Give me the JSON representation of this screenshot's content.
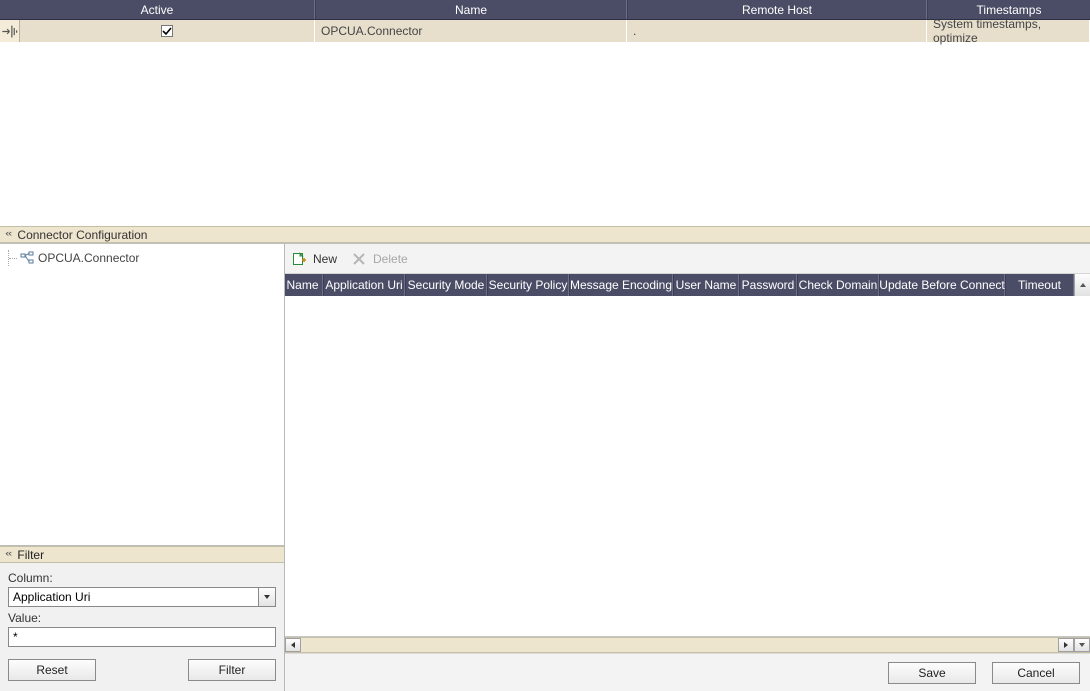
{
  "top_table": {
    "columns": {
      "active": "Active",
      "name": "Name",
      "remote_host": "Remote Host",
      "timestamps": "Timestamps"
    },
    "rows": [
      {
        "active_checked": true,
        "name": "OPCUA.Connector",
        "remote_host": ".",
        "timestamps": "System timestamps, optimize"
      }
    ]
  },
  "section": {
    "title": "Connector Configuration"
  },
  "tree": {
    "root_label": "OPCUA.Connector"
  },
  "filter": {
    "title": "Filter",
    "column_label": "Column:",
    "column_value": "Application Uri",
    "value_label": "Value:",
    "value_value": "*",
    "reset_label": "Reset",
    "filter_label": "Filter"
  },
  "toolbar": {
    "new_label": "New",
    "delete_label": "Delete"
  },
  "details_table": {
    "columns": [
      "Name",
      "Application Uri",
      "Security Mode",
      "Security Policy",
      "Message Encoding",
      "User Name",
      "Password",
      "Check Domain",
      "Update Before Connect",
      "Timeout"
    ]
  },
  "footer": {
    "save_label": "Save",
    "cancel_label": "Cancel"
  }
}
